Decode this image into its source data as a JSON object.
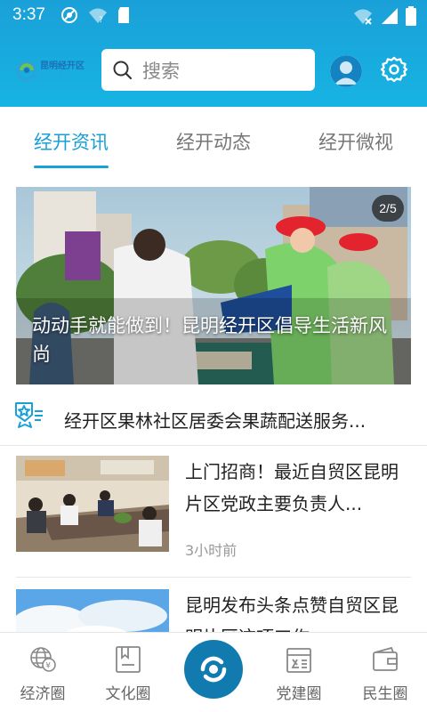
{
  "status_bar": {
    "time": "3:37",
    "left_icons": [
      "no-disturb-icon",
      "wifi-unknown-icon",
      "sd-card-icon"
    ],
    "right_icons": [
      "wifi-off-icon",
      "signal-icon",
      "battery-icon"
    ]
  },
  "header": {
    "logo": {
      "cn": "昆明经开区",
      "en": "KETDZ"
    },
    "search": {
      "placeholder": "搜索",
      "icon": "search-icon"
    },
    "avatar_icon": "avatar-icon",
    "settings_icon": "gear-icon"
  },
  "colors": {
    "accent": "#1aa0d8",
    "header_bg": "#17b4e3",
    "center_button": "#117bb0",
    "text_muted": "#999999"
  },
  "tabs": [
    {
      "label": "经开资讯",
      "active": true
    },
    {
      "label": "经开动态",
      "active": false
    },
    {
      "label": "经开微视",
      "active": false
    }
  ],
  "banner": {
    "counter": "2/5",
    "caption": "动动手就能做到！昆明经开区倡导生活新风尚"
  },
  "notice": {
    "icon": "announcement-icon",
    "text": "经开区果林社区居委会果蔬配送服务..."
  },
  "news": [
    {
      "title": "上门招商！最近自贸区昆明片区党政主要负责人...",
      "time": "3小时前"
    },
    {
      "title": "昆明发布头条点赞自贸区昆明片区这项工作"
    }
  ],
  "bottom_nav": [
    {
      "label": "经济圈",
      "icon": "globe-yuan-icon"
    },
    {
      "label": "文化圈",
      "icon": "book-icon"
    },
    {
      "label": "",
      "icon": "center-logo-icon"
    },
    {
      "label": "党建圈",
      "icon": "party-building-icon"
    },
    {
      "label": "民生圈",
      "icon": "wallet-icon"
    }
  ]
}
